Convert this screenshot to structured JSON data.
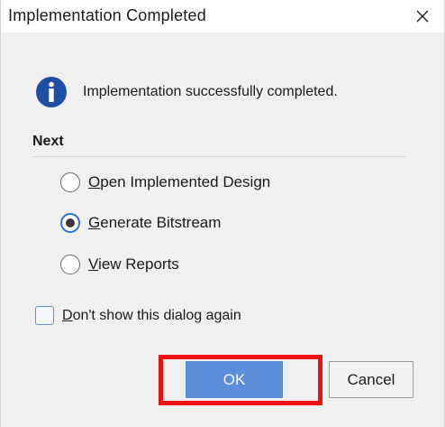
{
  "window": {
    "title": "Implementation Completed",
    "close_icon": "close-icon"
  },
  "message": {
    "icon": "info-icon",
    "text": "Implementation successfully completed."
  },
  "next": {
    "label": "Next",
    "options": [
      {
        "mnemonic": "O",
        "rest": "pen Implemented Design",
        "selected": false
      },
      {
        "mnemonic": "G",
        "rest": "enerate Bitstream",
        "selected": true
      },
      {
        "mnemonic": "V",
        "rest": "iew Reports",
        "selected": false
      }
    ]
  },
  "dont_show": {
    "mnemonic": "D",
    "rest": "on't show this dialog again",
    "checked": false
  },
  "buttons": {
    "ok": "OK",
    "cancel": "Cancel"
  },
  "colors": {
    "ok_bg": "#5b8ddb",
    "highlight": "#ee1111",
    "info_blue": "#1f4fa3"
  }
}
